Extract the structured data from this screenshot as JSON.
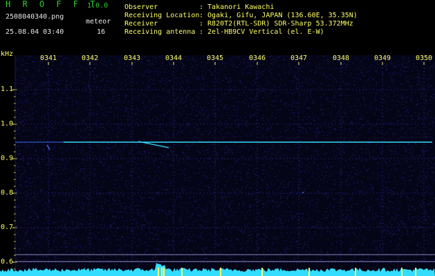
{
  "header": {
    "app_title": "H R O F F T",
    "app_version": "1.0.0",
    "file_name": "2508040340.png",
    "meteor_label": "meteor",
    "datetime": "25.08.04 03:40",
    "meteor_count": "16",
    "observer_label": "Observer",
    "observer_value": ": Takanori Kawachi",
    "location_label": "Receiving Location",
    "location_value": ": Ogaki, Gifu, JAPAN (136.60E, 35.35N)",
    "receiver_label": "Receiver",
    "receiver_value": ": R820T2(RTL-SDR) SDR-Sharp 53.372MHz",
    "antenna_label": "Receiving antenna",
    "antenna_value": ": 2el-HB9CV Vertical (el. E-W)"
  },
  "axis": {
    "unit": "kHz",
    "x_ticks": [
      "0341",
      "0342",
      "0343",
      "0344",
      "0345",
      "0346",
      "0347",
      "0348",
      "0349",
      "0350"
    ],
    "y_ticks": [
      "1.1",
      "1.0",
      "0.9",
      "0.8",
      "0.7",
      "0.6"
    ]
  },
  "colors": {
    "background": "#000000",
    "grid": "#1a1a5c",
    "noise": "#1c1c6e",
    "signal": "#33ddff",
    "text_green": "#33cc33",
    "text_yellow": "#ffff66",
    "baseline": "#8888bb"
  }
}
